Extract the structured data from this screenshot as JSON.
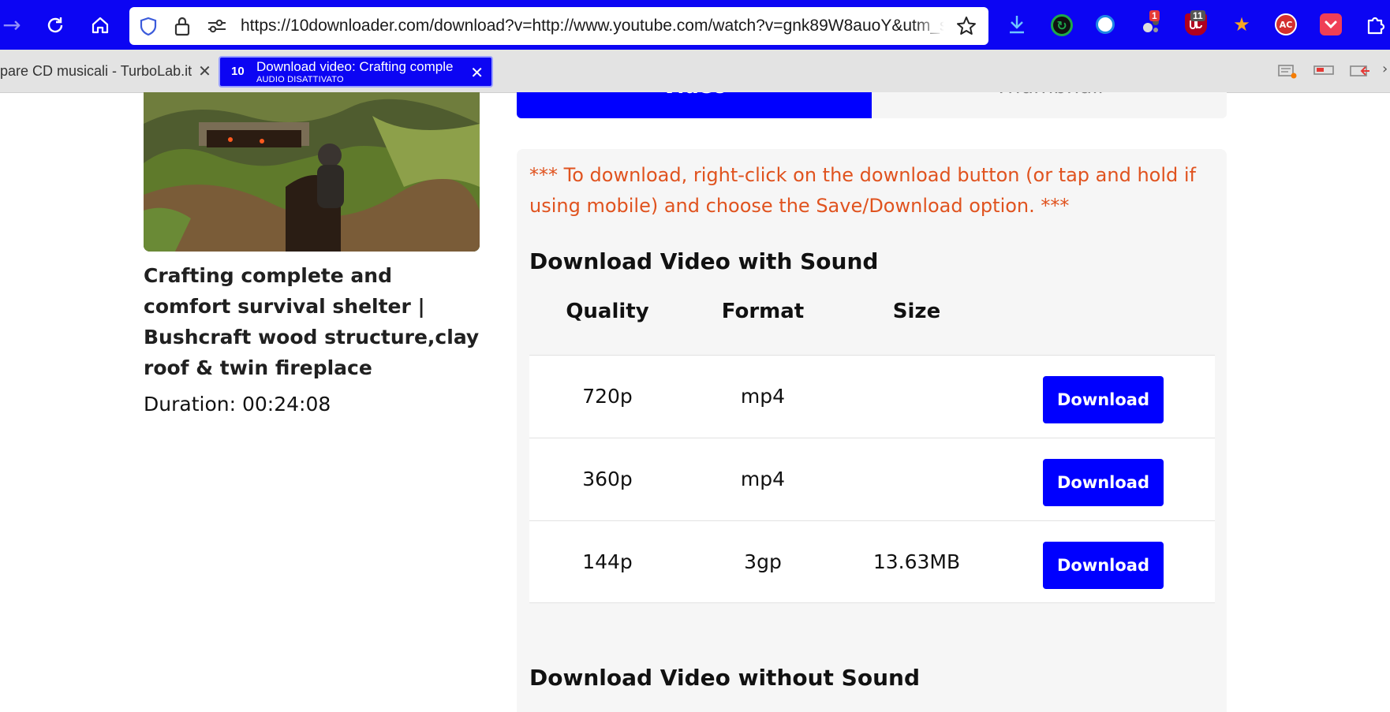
{
  "browser": {
    "url": "https://10downloader.com/download?v=http://www.youtube.com/watch?v=gnk89W8auoY&utm_source",
    "tabs": [
      {
        "title": "pare CD musicali - TurboLab.it",
        "active": false
      },
      {
        "title": "Download video: Crafting comple",
        "subtitle": "AUDIO DISATTIVATO",
        "favicon_text": "10",
        "active": true
      }
    ],
    "extension_badges": {
      "first": "1",
      "second": "11"
    },
    "extension_labels": {
      "ac": "AC"
    },
    "colors": {
      "toolbar": "#0c05f3",
      "accent": "#0000ff",
      "notice": "#e0531f"
    }
  },
  "page": {
    "view_tabs": {
      "video": "Video",
      "thumbnail": "Thumbnail"
    },
    "video_title": "Crafting complete and comfort survival shelter | Bushcraft wood structure,clay roof & twin fireplace",
    "duration_label": "Duration:",
    "duration": "00:24:08",
    "notice": "*** To download, right-click on the download button (or tap and hold if using mobile) and choose the Save/Download option. ***",
    "section_with_sound": "Download Video with Sound",
    "section_without_sound": "Download Video without Sound",
    "table": {
      "headers": {
        "quality": "Quality",
        "format": "Format",
        "size": "Size"
      },
      "rows": [
        {
          "quality": "720p",
          "format": "mp4",
          "size": "",
          "button": "Download"
        },
        {
          "quality": "360p",
          "format": "mp4",
          "size": "",
          "button": "Download"
        },
        {
          "quality": "144p",
          "format": "3gp",
          "size": "13.63MB",
          "button": "Download"
        }
      ]
    }
  }
}
